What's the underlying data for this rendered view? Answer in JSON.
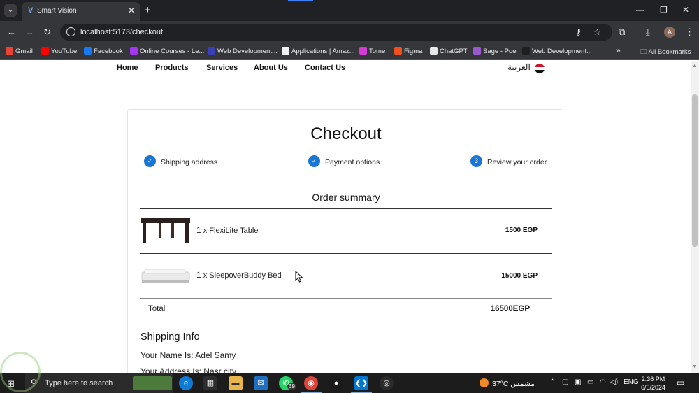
{
  "browser": {
    "tab_title": "Smart Vision",
    "url": "localhost:5173/checkout",
    "avatar_letter": "A",
    "bookmarks": [
      {
        "label": "Gmail",
        "color": "#ea4335"
      },
      {
        "label": "YouTube",
        "color": "#ff0000"
      },
      {
        "label": "Facebook",
        "color": "#1877f2"
      },
      {
        "label": "Online Courses - Le...",
        "color": "#a435f0"
      },
      {
        "label": "Web Development...",
        "color": "#3b3fb6"
      },
      {
        "label": "Applications | Amaz...",
        "color": "#f2f2f2"
      },
      {
        "label": "Tome",
        "color": "#d63bd6"
      },
      {
        "label": "Figma",
        "color": "#f24e1e"
      },
      {
        "label": "ChatGPT",
        "color": "#e8e8e8"
      },
      {
        "label": "Sage - Poe",
        "color": "#9b59d0"
      },
      {
        "label": "Web Development...",
        "color": "#1f1f1f"
      }
    ],
    "all_bookmarks_label": "All Bookmarks"
  },
  "nav": {
    "links": [
      "Home",
      "Products",
      "Services",
      "About Us",
      "Contact Us"
    ],
    "language": "العربية"
  },
  "checkout": {
    "title": "Checkout",
    "steps": [
      {
        "label": "Shipping address",
        "status": "done"
      },
      {
        "label": "Payment options",
        "status": "done"
      },
      {
        "label": "Review your order",
        "status": "active",
        "number": "3"
      }
    ],
    "summary_title": "Order summary",
    "items": [
      {
        "qty": "1",
        "name": "x FlexiLite Table",
        "price": "1500 EGP"
      },
      {
        "qty": "1",
        "name": "x SleepoverBuddy Bed",
        "price": "15000 EGP"
      }
    ],
    "total_label": "Total",
    "total_value": "16500EGP",
    "shipping_title": "Shipping Info",
    "shipping_lines": [
      "Your Name Is: Adel Samy",
      "Your Address Is: Nasr city"
    ]
  },
  "taskbar": {
    "search_placeholder": "Type here to search",
    "whatsapp_badge": "39",
    "weather": "37°C",
    "weather_text": "مشمس",
    "language": "ENG",
    "time": "2:36 PM",
    "date": "6/5/2024"
  },
  "colors": {
    "step_accent": "#1976d2",
    "browser_dark": "#202124",
    "browser_toolbar": "#35363a"
  }
}
